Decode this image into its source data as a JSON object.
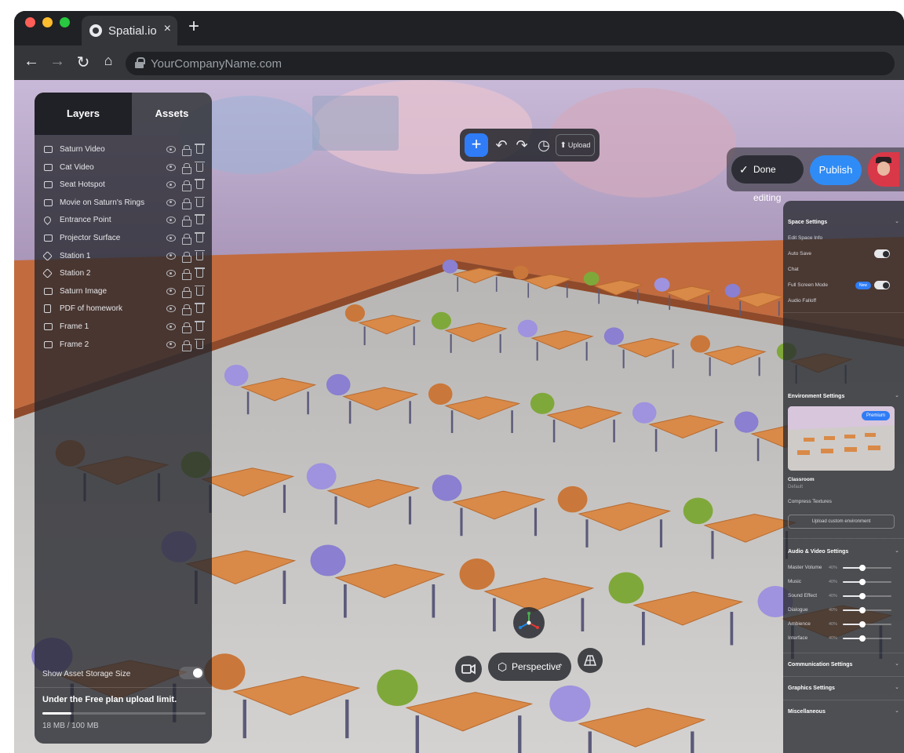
{
  "browser": {
    "tab_title": "Spatial.io",
    "tab_close": "×",
    "new_tab": "+",
    "url": "YourCompanyName.com",
    "nav": {
      "back": "←",
      "forward": "→",
      "reload": "↻",
      "home": "⌂"
    }
  },
  "left_panel": {
    "tabs": [
      "Layers",
      "Assets"
    ],
    "layers": [
      {
        "label": "Saturn Video",
        "icon": "video-icon"
      },
      {
        "label": "Cat Video",
        "icon": "video-icon"
      },
      {
        "label": "Seat Hotspot",
        "icon": "image-icon"
      },
      {
        "label": "Movie on Saturn's Rings",
        "icon": "video-icon"
      },
      {
        "label": "Entrance Point",
        "icon": "pin-icon"
      },
      {
        "label": "Projector Surface",
        "icon": "frame-icon"
      },
      {
        "label": "Station 1",
        "icon": "node-icon"
      },
      {
        "label": "Station 2",
        "icon": "node-icon"
      },
      {
        "label": "Saturn Image",
        "icon": "image-icon"
      },
      {
        "label": "PDF of homework",
        "icon": "pdf-icon"
      },
      {
        "label": "Frame 1",
        "icon": "frame-icon"
      },
      {
        "label": "Frame 2",
        "icon": "frame-icon"
      }
    ],
    "storage": {
      "toggle_label": "Show Asset Storage Size",
      "title": "Under the Free plan upload limit.",
      "readout": "18 MB / 100 MB",
      "used_fraction": 0.18
    }
  },
  "toolbar": {
    "add": "+",
    "undo": "↶",
    "redo": "↷",
    "history": "◷",
    "upload": "Upload",
    "upload_icon": "⬆"
  },
  "actions": {
    "done_check": "✓",
    "done": "Done editing",
    "publish": "Publish"
  },
  "right_panel": {
    "space_settings": {
      "title": "Space Settings",
      "items": [
        "Edit Space Info",
        "Auto Save",
        "Chat",
        "Full Screen Mode",
        "Audio Falloff"
      ],
      "new_badge": "New"
    },
    "environment_settings": {
      "title": "Environment Settings",
      "premium": "Premium",
      "environment_name": "Classroom",
      "environment_sub": "Default",
      "compress_textures": "Compress Textures",
      "upload_custom": "Upload custom environment"
    },
    "audio_video_settings": {
      "title": "Audio & Video Settings",
      "sliders": [
        {
          "label": "Master Volume",
          "value": 40
        },
        {
          "label": "Music",
          "value": 40
        },
        {
          "label": "Sound Effect",
          "value": 40
        },
        {
          "label": "Dialogue",
          "value": 40
        },
        {
          "label": "Ambience",
          "value": 40
        },
        {
          "label": "Interface",
          "value": 40
        }
      ]
    },
    "communication_settings": {
      "title": "Communication Settings"
    },
    "graphics_settings": {
      "title": "Graphics Settings"
    },
    "miscellaneous": {
      "title": "Miscellaneous"
    },
    "chevron": "⌄"
  },
  "bottom": {
    "camera_mode": "Perspective",
    "camera_icon": "⬡",
    "caret": "⌃"
  },
  "colors": {
    "accent": "#2f7cf6",
    "publish": "#2f8cf6",
    "floor": "#c9c6c4",
    "wood_floor": "#c26b3e",
    "desk_top": "#d98a48",
    "wall": "#b9a7c8"
  }
}
